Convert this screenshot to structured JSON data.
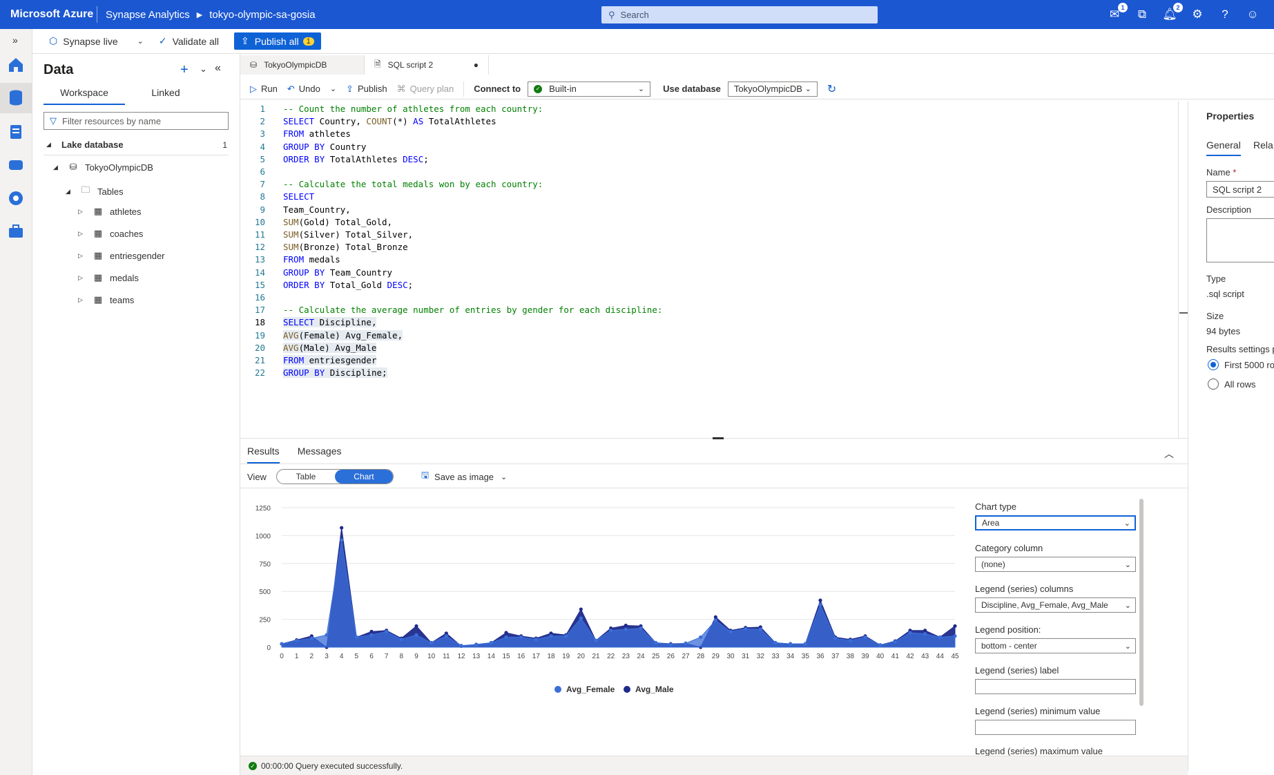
{
  "topbar": {
    "brand": "Microsoft Azure",
    "crumb1": "Synapse Analytics",
    "crumb2": "tokyo-olympic-sa-gosia",
    "search_placeholder": "Search",
    "notif_badge": "1",
    "bell_badge": "2"
  },
  "subbar": {
    "live": "Synapse live",
    "validate": "Validate all",
    "publish_all": "Publish all",
    "publish_count": "1"
  },
  "datapanel": {
    "title": "Data",
    "tabs": [
      "Workspace",
      "Linked"
    ],
    "filter_placeholder": "Filter resources by name",
    "lake_db": "Lake database",
    "lake_db_count": "1",
    "db_name": "TokyoOlympicDB",
    "tables_folder": "Tables",
    "tables": [
      "athletes",
      "coaches",
      "entriesgender",
      "medals",
      "teams"
    ]
  },
  "editor_tabs": [
    {
      "label": "TokyoOlympicDB"
    },
    {
      "label": "SQL script 2",
      "modified_marker": "●"
    }
  ],
  "editor_toolbar": {
    "run": "Run",
    "undo": "Undo",
    "publish": "Publish",
    "query_plan": "Query plan",
    "connect_to": "Connect to",
    "connect_value": "Built-in",
    "use_database": "Use database",
    "database_value": "TokyoOlympicDB"
  },
  "code_lines": [
    "-- Count the number of athletes from each country:",
    "SELECT Country, COUNT(*) AS TotalAthletes",
    "FROM athletes",
    "GROUP BY Country",
    "ORDER BY TotalAthletes DESC;",
    "",
    "-- Calculate the total medals won by each country:",
    "SELECT",
    "Team_Country,",
    "SUM(Gold) Total_Gold,",
    "SUM(Silver) Total_Silver,",
    "SUM(Bronze) Total_Bronze",
    "FROM medals",
    "GROUP BY Team_Country",
    "ORDER BY Total_Gold DESC;",
    "",
    "-- Calculate the average number of entries by gender for each discipline:",
    "SELECT Discipline,",
    "AVG(Female) Avg_Female,",
    "AVG(Male) Avg_Male",
    "FROM entriesgender",
    "GROUP BY Discipline;"
  ],
  "properties": {
    "title": "Properties",
    "tab_general": "General",
    "tab_related": "Rela",
    "name_label": "Name",
    "required_marker": "*",
    "name_value": "SQL script 2",
    "description_label": "Description",
    "type_label": "Type",
    "type_value": ".sql script",
    "size_label": "Size",
    "size_value": "94 bytes",
    "results_settings": "Results settings p",
    "first_rows": "First 5000 ro",
    "all_rows": "All rows"
  },
  "results": {
    "tabs": [
      "Results",
      "Messages"
    ],
    "view_label": "View",
    "view_table": "Table",
    "view_chart": "Chart",
    "save_image": "Save as image"
  },
  "chart_settings": {
    "chart_type_label": "Chart type",
    "chart_type_value": "Area",
    "category_label": "Category column",
    "category_value": "(none)",
    "legend_cols_label": "Legend (series) columns",
    "legend_cols_value": "Discipline, Avg_Female, Avg_Male",
    "legend_pos_label": "Legend position:",
    "legend_pos_value": "bottom - center",
    "series_label_label": "Legend (series) label",
    "series_min_label": "Legend (series) minimum value",
    "series_max_label": "Legend (series) maximum value"
  },
  "chart_data": {
    "type": "area",
    "x": [
      0,
      1,
      2,
      3,
      4,
      5,
      6,
      7,
      8,
      9,
      10,
      11,
      12,
      13,
      14,
      15,
      16,
      17,
      18,
      19,
      20,
      21,
      22,
      23,
      24,
      25,
      26,
      27,
      28,
      29,
      30,
      31,
      32,
      33,
      34,
      35,
      36,
      37,
      38,
      39,
      40,
      41,
      42,
      43,
      44,
      45
    ],
    "series": [
      {
        "name": "Avg_Female",
        "color": "#3b6fd8",
        "values": [
          30,
          60,
          80,
          110,
          960,
          90,
          110,
          140,
          70,
          110,
          40,
          100,
          15,
          25,
          40,
          90,
          90,
          70,
          100,
          100,
          260,
          60,
          150,
          160,
          170,
          40,
          25,
          35,
          90,
          240,
          140,
          165,
          160,
          40,
          30,
          30,
          380,
          80,
          60,
          90,
          20,
          50,
          130,
          120,
          90,
          100
        ]
      },
      {
        "name": "Avg_Male",
        "color": "#1f2a8c",
        "values": [
          30,
          65,
          100,
          0,
          1070,
          90,
          140,
          150,
          80,
          190,
          40,
          125,
          10,
          25,
          40,
          130,
          100,
          80,
          125,
          110,
          340,
          60,
          170,
          195,
          190,
          40,
          30,
          35,
          0,
          270,
          150,
          175,
          180,
          40,
          30,
          30,
          420,
          90,
          70,
          100,
          20,
          55,
          150,
          150,
          90,
          190
        ]
      }
    ],
    "ylim": [
      0,
      1250
    ],
    "yticks": [
      0,
      250,
      500,
      750,
      1000,
      1250
    ],
    "legend_position": "bottom-center",
    "grid": true
  },
  "status": {
    "text": "00:00:00 Query executed successfully."
  }
}
